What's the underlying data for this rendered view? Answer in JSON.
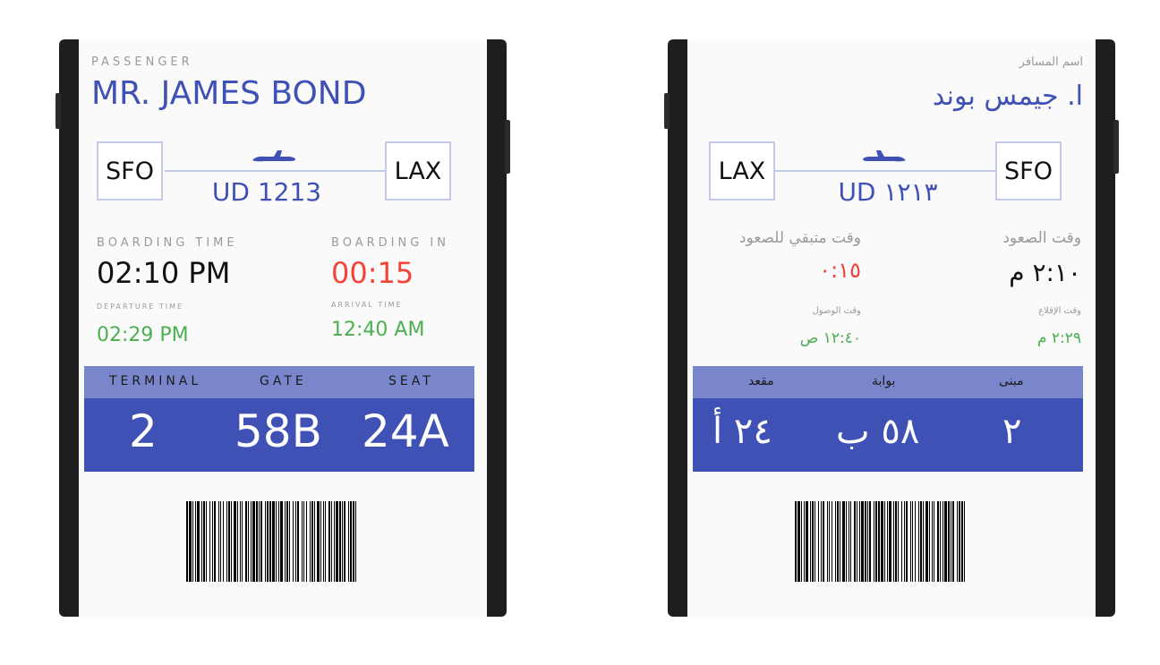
{
  "english": {
    "passenger_label": "PASSENGER",
    "passenger_name": "MR. JAMES BOND",
    "origin": "SFO",
    "destination": "LAX",
    "flight": "UD 1213",
    "boarding_time_label": "BOARDING TIME",
    "boarding_time": "02:10 PM",
    "boarding_in_label": "BOARDING IN",
    "boarding_in": "00:15",
    "departure_label": "DEPARTURE TIME",
    "departure_time": "02:29 PM",
    "arrival_label": "ARRIVAL TIME",
    "arrival_time": "12:40 AM",
    "terminal_label": "TERMINAL",
    "gate_label": "GATE",
    "seat_label": "SEAT",
    "terminal": "2",
    "gate": "58B",
    "seat": "24A"
  },
  "arabic": {
    "passenger_label": "اسم المسافر",
    "passenger_name": "ا. جيمس بوند",
    "origin": "SFO",
    "destination": "LAX",
    "flight": "UD ١٢١٣",
    "boarding_time_label": "وقت الصعود",
    "boarding_time": "٢:١٠ م",
    "boarding_in_label": "وقت متبقي للصعود",
    "boarding_in": "٠:١٥",
    "departure_label": "وقت الإقلاع",
    "departure_time": "٢:٢٩ م",
    "arrival_label": "وقت الوصول",
    "arrival_time": "١٢:٤٠ ص",
    "terminal_label": "مبنى",
    "gate_label": "بوابة",
    "seat_label": "مقعد",
    "terminal": "٢",
    "gate": "٥٨ ب",
    "seat": "٢٤ أ"
  },
  "icons": {
    "plane": "airplane-icon",
    "barcode": "barcode-icon"
  },
  "colors": {
    "primary": "#3f51b5",
    "band_head": "#7986cb",
    "countdown": "#f44336",
    "times": "#4caf50"
  }
}
